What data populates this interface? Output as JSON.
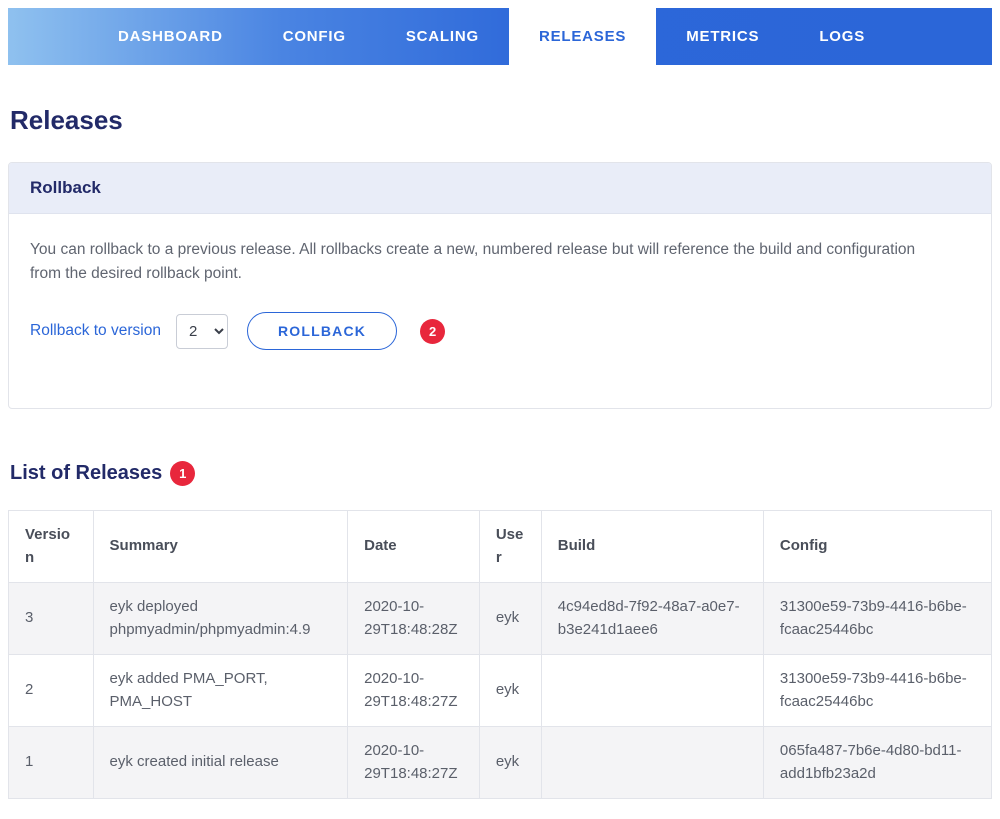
{
  "nav": {
    "items": [
      {
        "label": "DASHBOARD",
        "active": false
      },
      {
        "label": "CONFIG",
        "active": false
      },
      {
        "label": "SCALING",
        "active": false
      },
      {
        "label": "RELEASES",
        "active": true
      },
      {
        "label": "METRICS",
        "active": false
      },
      {
        "label": "LOGS",
        "active": false
      }
    ]
  },
  "page": {
    "title": "Releases"
  },
  "rollback_card": {
    "header": "Rollback",
    "description": "You can rollback to a previous release. All rollbacks create a new, numbered release but will reference the build and configuration from the desired rollback point.",
    "label": "Rollback to version",
    "selected_version": "2",
    "button_label": "ROLLBACK",
    "badge": "2"
  },
  "releases": {
    "heading": "List of Releases",
    "badge": "1",
    "columns": [
      "Version",
      "Summary",
      "Date",
      "User",
      "Build",
      "Config"
    ],
    "rows": [
      {
        "version": "3",
        "summary": "eyk deployed phpmyadmin/phpmyadmin:4.9",
        "date": "2020-10-29T18:48:28Z",
        "user": "eyk",
        "build": "4c94ed8d-7f92-48a7-a0e7-b3e241d1aee6",
        "config": "31300e59-73b9-4416-b6be-fcaac25446bc"
      },
      {
        "version": "2",
        "summary": "eyk added PMA_PORT, PMA_HOST",
        "date": "2020-10-29T18:48:27Z",
        "user": "eyk",
        "build": "",
        "config": "31300e59-73b9-4416-b6be-fcaac25446bc"
      },
      {
        "version": "1",
        "summary": "eyk created initial release",
        "date": "2020-10-29T18:48:27Z",
        "user": "eyk",
        "build": "",
        "config": "065fa487-7b6e-4d80-bd11-add1bfb23a2d"
      }
    ]
  },
  "colors": {
    "accent_blue": "#2b66d8",
    "nav_gradient_start": "#8fc1ef",
    "nav_gradient_end": "#2b66d8",
    "heading_navy": "#222a68",
    "badge_red": "#e8273c",
    "card_header_bg": "#e9edf8",
    "row_alt_bg": "#f4f4f6"
  }
}
